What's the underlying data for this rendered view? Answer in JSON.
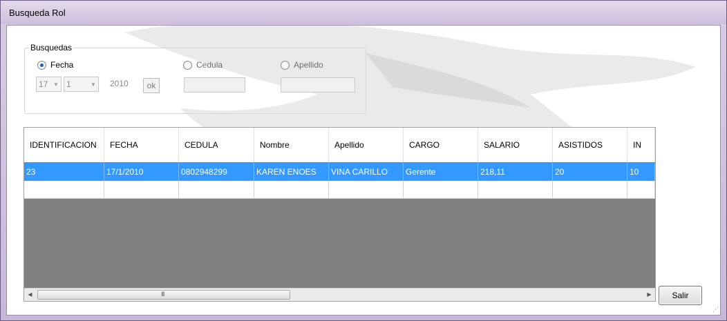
{
  "window": {
    "title": "Busqueda Rol"
  },
  "search_group": {
    "legend": "Busquedas",
    "radios": {
      "fecha": {
        "label": "Fecha",
        "checked": true
      },
      "cedula": {
        "label": "Cedula",
        "checked": false
      },
      "apellido": {
        "label": "Apellido",
        "checked": false
      }
    },
    "day_combo": "17",
    "month_combo": "1",
    "year_value": "2010",
    "ok_label": "ok",
    "cedula_value": "",
    "apellido_value": ""
  },
  "grid": {
    "columns": [
      "IDENTIFICACION",
      "FECHA",
      "CEDULA",
      "Nombre",
      "Apellido",
      "CARGO",
      "SALARIO",
      "ASISTIDOS",
      "IN"
    ],
    "rows": [
      [
        "23",
        "17/1/2010",
        "0802948299",
        "KAREN ENOES",
        "VINA CARILLO",
        "Gerente",
        "218,11",
        "20",
        "10"
      ]
    ],
    "scrollbar": {
      "left_arrow": "◀",
      "right_arrow": "▶",
      "grip": "III"
    }
  },
  "salir_label": "Salir",
  "colors": {
    "selection": "#3399ff",
    "grid_background": "#808080"
  }
}
